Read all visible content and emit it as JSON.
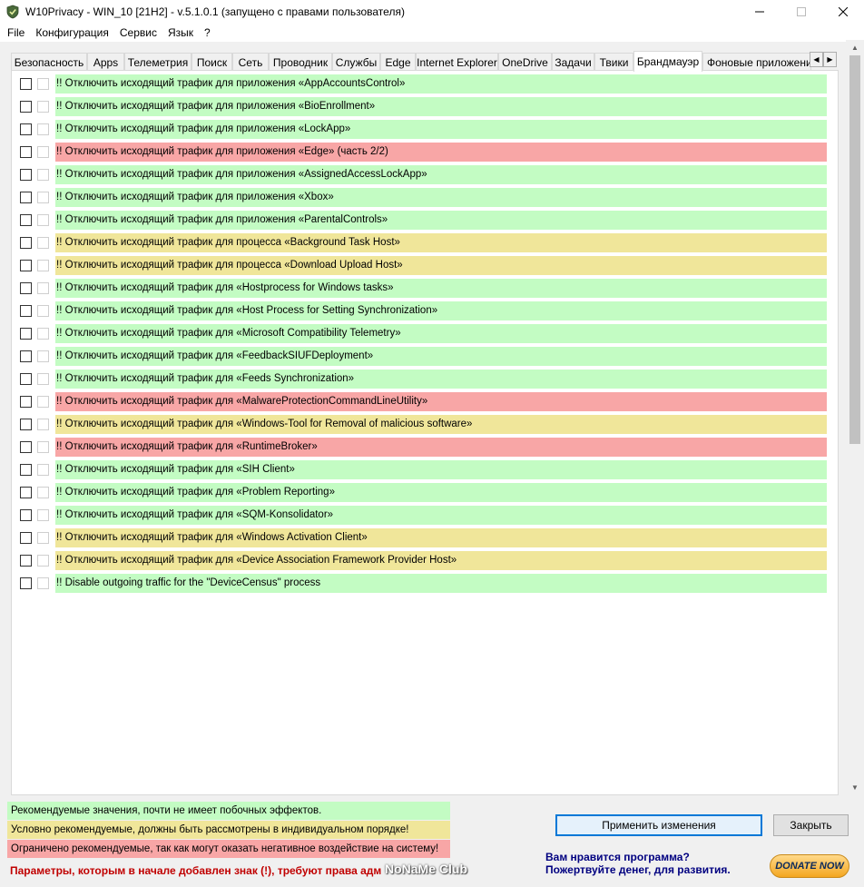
{
  "window": {
    "title": "W10Privacy - WIN_10 [21H2]  - v.5.1.0.1 (запущено с правами пользователя)"
  },
  "menu": [
    "File",
    "Конфигурация",
    "Сервис",
    "Язык",
    "?"
  ],
  "tabs": [
    {
      "label": "Безопасность"
    },
    {
      "label": "Apps"
    },
    {
      "label": "Телеметрия"
    },
    {
      "label": "Поиск"
    },
    {
      "label": "Сеть"
    },
    {
      "label": "Проводник"
    },
    {
      "label": "Службы"
    },
    {
      "label": "Edge"
    },
    {
      "label": "Internet Explorer"
    },
    {
      "label": "OneDrive"
    },
    {
      "label": "Задачи"
    },
    {
      "label": "Твики"
    },
    {
      "label": "Брандмауэр",
      "active": true
    },
    {
      "label": "Фоновые приложения"
    }
  ],
  "colors": {
    "green": "#c3fcc3",
    "yellow": "#f0e69a",
    "red": "#f8a6a6",
    "accent": "#0078d7"
  },
  "rules": [
    {
      "label": "!! Отключить исходящий трафик для приложения «AppAccountsControl»",
      "level": "green"
    },
    {
      "label": "!! Отключить исходящий трафик для приложения «BioEnrollment»",
      "level": "green"
    },
    {
      "label": "!! Отключить исходящий трафик для приложения «LockApp»",
      "level": "green"
    },
    {
      "label": "!! Отключить исходящий трафик для приложения «Edge» (часть 2/2)",
      "level": "red"
    },
    {
      "label": "!! Отключить исходящий трафик для приложения «AssignedAccessLockApp»",
      "level": "green"
    },
    {
      "label": "!! Отключить исходящий трафик для приложения «Xbox»",
      "level": "green"
    },
    {
      "label": "!! Отключить исходящий трафик для приложения «ParentalControls»",
      "level": "green"
    },
    {
      "label": "!! Отключить исходящий трафик для процесса «Background Task Host»",
      "level": "yellow"
    },
    {
      "label": "!! Отключить исходящий трафик для процесса «Download Upload Host»",
      "level": "yellow"
    },
    {
      "label": "!! Отключить исходящий трафик для «Hostprocess for Windows tasks»",
      "level": "green"
    },
    {
      "label": "!! Отключить исходящий трафик для «Host Process for Setting Synchronization»",
      "level": "green"
    },
    {
      "label": "!! Отключить исходящий трафик для «Microsoft Compatibility Telemetry»",
      "level": "green"
    },
    {
      "label": "!! Отключить исходящий трафик для «FeedbackSIUFDeployment»",
      "level": "green"
    },
    {
      "label": "!! Отключить исходящий трафик для «Feeds Synchronization»",
      "level": "green"
    },
    {
      "label": "!! Отключить исходящий трафик для «MalwareProtectionCommandLineUtility»",
      "level": "red"
    },
    {
      "label": "!! Отключить исходящий трафик для «Windows-Tool for Removal of malicious software»",
      "level": "yellow"
    },
    {
      "label": "!! Отключить исходящий трафик для «RuntimeBroker»",
      "level": "red"
    },
    {
      "label": "!! Отключить исходящий трафик для «SIH Client»",
      "level": "green"
    },
    {
      "label": "!! Отключить исходящий трафик для «Problem Reporting»",
      "level": "green"
    },
    {
      "label": "!! Отключить исходящий трафик для «SQM-Konsolidator»",
      "level": "green"
    },
    {
      "label": "!! Отключить исходящий трафик для «Windows Activation Client»",
      "level": "yellow"
    },
    {
      "label": "!! Отключить исходящий трафик для «Device Association Framework Provider Host»",
      "level": "yellow"
    },
    {
      "label": "!! Disable outgoing traffic for the \"DeviceCensus\" process",
      "level": "green"
    }
  ],
  "legend": {
    "green": "Рекомендуемые значения, почти не имеет побочных эффектов.",
    "yellow": "Условно рекомендуемые, должны быть рассмотрены в индивидуальном порядке!",
    "red": "Ограничено рекомендуемые, так как могут оказать негативное воздействие на систему!"
  },
  "footer_note": "Параметры, которым в начале добавлен знак (!), требуют права адм",
  "watermark": "NoNaMe Club",
  "buttons": {
    "apply": "Применить изменения",
    "close": "Закрыть",
    "donate": "DONATE NOW"
  },
  "promo": {
    "line1": "Вам нравится программа?",
    "line2": "Пожертвуйте денег, для развития."
  }
}
